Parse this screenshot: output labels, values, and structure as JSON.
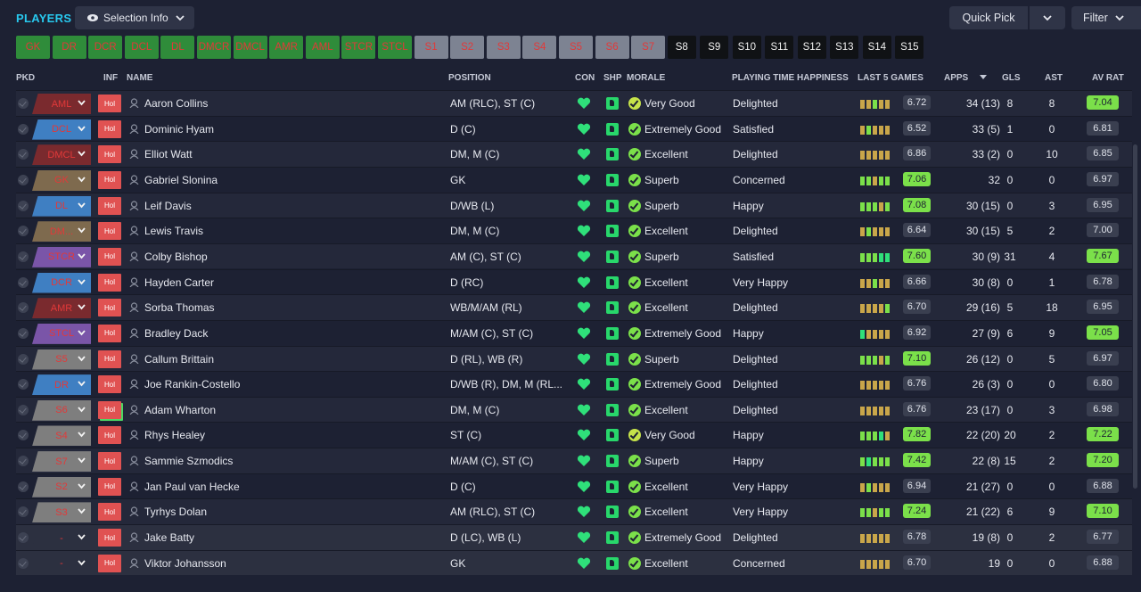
{
  "header": {
    "title": "PLAYERS",
    "selection_info_label": "Selection Info",
    "quick_pick_label": "Quick Pick",
    "filter_label": "Filter"
  },
  "positions": [
    {
      "label": "GK",
      "state": "filled"
    },
    {
      "label": "DR",
      "state": "filled"
    },
    {
      "label": "DCR",
      "state": "filled"
    },
    {
      "label": "DCL",
      "state": "filled"
    },
    {
      "label": "DL",
      "state": "filled"
    },
    {
      "label": "DMCR",
      "state": "filled"
    },
    {
      "label": "DMCL",
      "state": "filled"
    },
    {
      "label": "AMR",
      "state": "filled"
    },
    {
      "label": "AML",
      "state": "filled"
    },
    {
      "label": "STCR",
      "state": "filled"
    },
    {
      "label": "STCL",
      "state": "filled"
    },
    {
      "label": "S1",
      "state": "sub"
    },
    {
      "label": "S2",
      "state": "sub"
    },
    {
      "label": "S3",
      "state": "sub"
    },
    {
      "label": "S4",
      "state": "sub"
    },
    {
      "label": "S5",
      "state": "sub"
    },
    {
      "label": "S6",
      "state": "sub"
    },
    {
      "label": "S7",
      "state": "sub"
    },
    {
      "label": "S8",
      "state": "empty"
    },
    {
      "label": "S9",
      "state": "empty"
    },
    {
      "label": "S10",
      "state": "empty"
    },
    {
      "label": "S11",
      "state": "empty"
    },
    {
      "label": "S12",
      "state": "empty"
    },
    {
      "label": "S13",
      "state": "empty"
    },
    {
      "label": "S14",
      "state": "empty"
    },
    {
      "label": "S15",
      "state": "empty"
    }
  ],
  "columns": {
    "pkd": "PKD",
    "inf": "INF",
    "name": "NAME",
    "position": "POSITION",
    "con": "CON",
    "shp": "SHP",
    "morale": "MORALE",
    "pth": "PLAYING TIME HAPPINESS",
    "last5": "LAST 5 GAMES",
    "apps": "APPS",
    "gls": "GLS",
    "ast": "AST",
    "avrat": "AV RAT"
  },
  "colors": {
    "accent": "#28c9ef",
    "filled_slot": "#2f8c3a",
    "sub_slot": "#7d8392",
    "empty_slot": "#101215",
    "slot_text": "#e23939",
    "good_green": "#7be04a",
    "inf_red": "#e05252"
  },
  "players": [
    {
      "pkd": "AML",
      "pkd_color": "#7a2a2e",
      "inf": "Hol",
      "name": "Aaron Collins",
      "position": "AM (RLC), ST (C)",
      "morale": "Very Good",
      "pth": "Delighted",
      "last5": [
        "#c9a64a",
        "#c9a64a",
        "#7be04a",
        "#c9a64a",
        "#c9a64a"
      ],
      "last5_val": "6.72",
      "apps": "34 (13)",
      "gls": "8",
      "ast": "8",
      "avrat": "7.04",
      "avr_hi": true,
      "l5_hi": false
    },
    {
      "pkd": "DCL",
      "pkd_color": "#3f7fc2",
      "inf": "Hol",
      "name": "Dominic Hyam",
      "position": "D (C)",
      "morale": "Extremely Good",
      "pth": "Satisfied",
      "last5": [
        "#c9a64a",
        "#7be04a",
        "#c9a64a",
        "#c9a64a",
        "#c9a64a"
      ],
      "last5_val": "6.52",
      "apps": "33 (5)",
      "gls": "1",
      "ast": "0",
      "avrat": "6.81",
      "avr_hi": false,
      "l5_hi": false
    },
    {
      "pkd": "DMCL",
      "pkd_color": "#7a2a2e",
      "inf": "Hol",
      "name": "Elliot Watt",
      "position": "DM, M (C)",
      "morale": "Excellent",
      "pth": "Delighted",
      "last5": [
        "#c9a64a",
        "#c9a64a",
        "#c9a64a",
        "#c9a64a",
        "#c9a64a"
      ],
      "last5_val": "6.86",
      "apps": "33 (2)",
      "gls": "0",
      "ast": "10",
      "avrat": "6.85",
      "avr_hi": false,
      "l5_hi": false
    },
    {
      "pkd": "GK",
      "pkd_color": "#7e6a4e",
      "inf": "Hol",
      "name": "Gabriel Slonina",
      "position": "GK",
      "morale": "Superb",
      "pth": "Concerned",
      "last5": [
        "#7be04a",
        "#7be04a",
        "#c9a64a",
        "#7be04a",
        "#7be04a"
      ],
      "last5_val": "7.06",
      "apps": "32",
      "gls": "0",
      "ast": "0",
      "avrat": "6.97",
      "avr_hi": false,
      "l5_hi": true
    },
    {
      "pkd": "DL",
      "pkd_color": "#3f7fc2",
      "inf": "Hol",
      "name": "Leif Davis",
      "position": "D/WB (L)",
      "morale": "Superb",
      "pth": "Happy",
      "last5": [
        "#7be04a",
        "#7be04a",
        "#7be04a",
        "#c9a64a",
        "#7be04a"
      ],
      "last5_val": "7.08",
      "apps": "30 (15)",
      "gls": "0",
      "ast": "3",
      "avrat": "6.95",
      "avr_hi": false,
      "l5_hi": true
    },
    {
      "pkd": "DM...",
      "pkd_color": "#7e6a4e",
      "inf": "Hol",
      "name": "Lewis Travis",
      "position": "DM, M (C)",
      "morale": "Excellent",
      "pth": "Delighted",
      "last5": [
        "#c9a64a",
        "#7be04a",
        "#c9a64a",
        "#c9a64a",
        "#c9a64a"
      ],
      "last5_val": "6.64",
      "apps": "30 (15)",
      "gls": "5",
      "ast": "2",
      "avrat": "7.00",
      "avr_hi": false,
      "l5_hi": false
    },
    {
      "pkd": "STCR",
      "pkd_color": "#7a55a8",
      "inf": "Hol",
      "name": "Colby Bishop",
      "position": "AM (C), ST (C)",
      "morale": "Superb",
      "pth": "Satisfied",
      "last5": [
        "#7be04a",
        "#7be04a",
        "#7be04a",
        "#2fe07a",
        "#2fe07a"
      ],
      "last5_val": "7.60",
      "apps": "30 (9)",
      "gls": "31",
      "ast": "4",
      "avrat": "7.67",
      "avr_hi": true,
      "l5_hi": true
    },
    {
      "pkd": "DCR",
      "pkd_color": "#3f7fc2",
      "inf": "Hol",
      "name": "Hayden Carter",
      "position": "D (RC)",
      "morale": "Excellent",
      "pth": "Very Happy",
      "last5": [
        "#c9a64a",
        "#c9a64a",
        "#7be04a",
        "#c9a64a",
        "#c9a64a"
      ],
      "last5_val": "6.66",
      "apps": "30 (8)",
      "gls": "0",
      "ast": "1",
      "avrat": "6.78",
      "avr_hi": false,
      "l5_hi": false
    },
    {
      "pkd": "AMR",
      "pkd_color": "#7a2a2e",
      "inf": "Hol",
      "name": "Sorba Thomas",
      "position": "WB/M/AM (RL)",
      "morale": "Excellent",
      "pth": "Delighted",
      "last5": [
        "#c9a64a",
        "#c9a64a",
        "#c9a64a",
        "#c9a64a",
        "#7be04a"
      ],
      "last5_val": "6.70",
      "apps": "29 (16)",
      "gls": "5",
      "ast": "18",
      "avrat": "6.95",
      "avr_hi": false,
      "l5_hi": false
    },
    {
      "pkd": "STCL",
      "pkd_color": "#7a55a8",
      "inf": "Hol",
      "name": "Bradley Dack",
      "position": "M/AM (C), ST (C)",
      "morale": "Extremely Good",
      "pth": "Happy",
      "last5": [
        "#2fe07a",
        "#c9a64a",
        "#c9a64a",
        "#c9a64a",
        "#c9a64a"
      ],
      "last5_val": "6.92",
      "apps": "27 (9)",
      "gls": "6",
      "ast": "9",
      "avrat": "7.05",
      "avr_hi": true,
      "l5_hi": false
    },
    {
      "pkd": "S5",
      "pkd_color": "#7e7e7e",
      "inf": "Hol",
      "name": "Callum Brittain",
      "position": "D (RL), WB (R)",
      "morale": "Superb",
      "pth": "Delighted",
      "last5": [
        "#7be04a",
        "#7be04a",
        "#7be04a",
        "#c9a64a",
        "#7be04a"
      ],
      "last5_val": "7.10",
      "apps": "26 (12)",
      "gls": "0",
      "ast": "5",
      "avrat": "6.97",
      "avr_hi": false,
      "l5_hi": true
    },
    {
      "pkd": "DR",
      "pkd_color": "#3f7fc2",
      "inf": "Hol",
      "name": "Joe Rankin-Costello",
      "position": "D/WB (R), DM, M (RL...",
      "morale": "Extremely Good",
      "pth": "Delighted",
      "last5": [
        "#c9a64a",
        "#c9a64a",
        "#c9a64a",
        "#c9a64a",
        "#c9a64a"
      ],
      "last5_val": "6.76",
      "apps": "26 (3)",
      "gls": "0",
      "ast": "0",
      "avrat": "6.80",
      "avr_hi": false,
      "l5_hi": false
    },
    {
      "pkd": "S6",
      "pkd_color": "#7e7e7e",
      "inf": "Hol",
      "name": "Adam Wharton",
      "position": "DM, M (C)",
      "morale": "Excellent",
      "pth": "Delighted",
      "last5": [
        "#c9a64a",
        "#c9a64a",
        "#c9a64a",
        "#c9a64a",
        "#c9a64a"
      ],
      "last5_val": "6.76",
      "apps": "23 (17)",
      "gls": "0",
      "ast": "3",
      "avrat": "6.98",
      "avr_hi": false,
      "l5_hi": false
    },
    {
      "pkd": "S4",
      "pkd_color": "#7e7e7e",
      "inf": "Hol",
      "name": "Rhys Healey",
      "position": "ST (C)",
      "morale": "Very Good",
      "pth": "Happy",
      "last5": [
        "#7be04a",
        "#7be04a",
        "#7be04a",
        "#2fe07a",
        "#c9a64a"
      ],
      "last5_val": "7.82",
      "apps": "22 (20)",
      "gls": "20",
      "ast": "2",
      "avrat": "7.22",
      "avr_hi": true,
      "l5_hi": true
    },
    {
      "pkd": "S7",
      "pkd_color": "#7e7e7e",
      "inf": "Hol",
      "name": "Sammie Szmodics",
      "position": "M/AM (C), ST (C)",
      "morale": "Superb",
      "pth": "Happy",
      "last5": [
        "#7be04a",
        "#2fe07a",
        "#7be04a",
        "#7be04a",
        "#7be04a"
      ],
      "last5_val": "7.42",
      "apps": "22 (8)",
      "gls": "15",
      "ast": "2",
      "avrat": "7.20",
      "avr_hi": true,
      "l5_hi": true
    },
    {
      "pkd": "S2",
      "pkd_color": "#7e7e7e",
      "inf": "Hol",
      "name": "Jan Paul van Hecke",
      "position": "D (C)",
      "morale": "Excellent",
      "pth": "Very Happy",
      "last5": [
        "#c9a64a",
        "#7be04a",
        "#c9a64a",
        "#c9a64a",
        "#c9a64a"
      ],
      "last5_val": "6.94",
      "apps": "21 (27)",
      "gls": "0",
      "ast": "0",
      "avrat": "6.88",
      "avr_hi": false,
      "l5_hi": false
    },
    {
      "pkd": "S3",
      "pkd_color": "#7e7e7e",
      "inf": "Hol",
      "name": "Tyrhys Dolan",
      "position": "AM (RLC), ST (C)",
      "morale": "Excellent",
      "pth": "Very Happy",
      "last5": [
        "#7be04a",
        "#7be04a",
        "#c9a64a",
        "#7be04a",
        "#7be04a"
      ],
      "last5_val": "7.24",
      "apps": "21 (22)",
      "gls": "6",
      "ast": "9",
      "avrat": "7.10",
      "avr_hi": true,
      "l5_hi": true
    },
    {
      "pkd": "-",
      "pkd_color": "#2c3040",
      "inf": "Hol",
      "name": "Jake Batty",
      "position": "D (LC), WB (L)",
      "morale": "Extremely Good",
      "pth": "Delighted",
      "last5": [
        "#c9a64a",
        "#c9a64a",
        "#c9a64a",
        "#c9a64a",
        "#c9a64a"
      ],
      "last5_val": "6.78",
      "apps": "19 (8)",
      "gls": "0",
      "ast": "2",
      "avrat": "6.77",
      "avr_hi": false,
      "l5_hi": false
    },
    {
      "pkd": "-",
      "pkd_color": "#2c3040",
      "inf": "Hol",
      "name": "Viktor Johansson",
      "position": "GK",
      "morale": "Excellent",
      "pth": "Concerned",
      "last5": [
        "#c9a64a",
        "#c9a64a",
        "#c9a64a",
        "#c9a64a",
        "#c9a64a"
      ],
      "last5_val": "6.70",
      "apps": "19",
      "gls": "0",
      "ast": "0",
      "avrat": "6.88",
      "avr_hi": false,
      "l5_hi": false
    }
  ]
}
